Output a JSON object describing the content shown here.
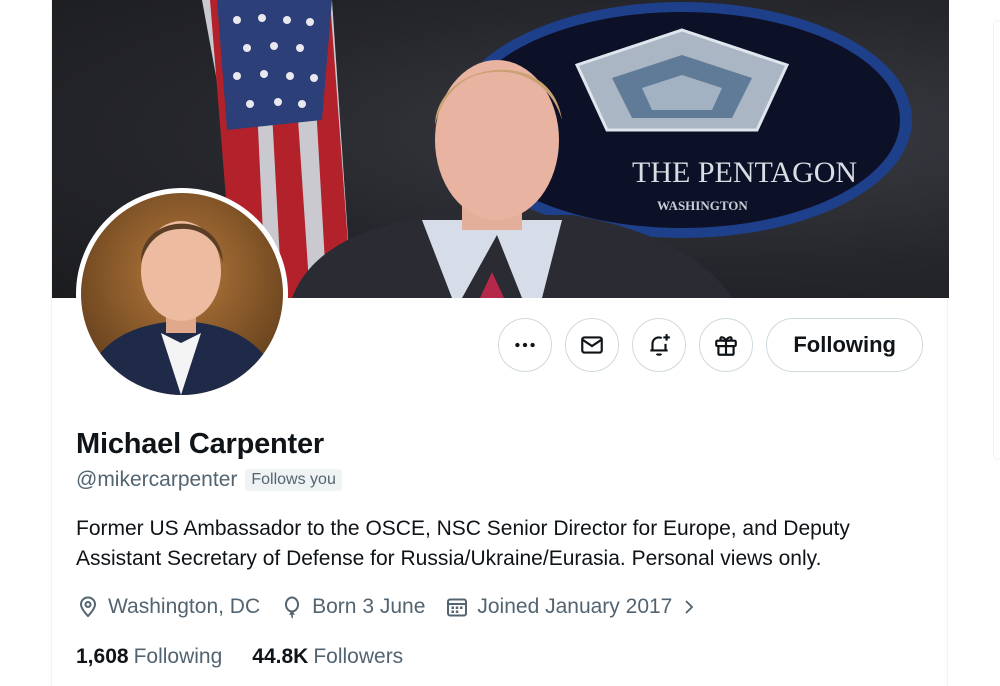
{
  "banner": {
    "sign_title": "THE PENTAGON",
    "sign_subtitle": "WASHINGTON"
  },
  "actions": {
    "more_icon": "more-icon",
    "message_icon": "envelope-icon",
    "notify_icon": "bell-plus-icon",
    "subscribe_icon": "gift-icon",
    "follow_label": "Following"
  },
  "profile": {
    "name": "Michael Carpenter",
    "handle": "@mikercarpenter",
    "follows_you": "Follows you",
    "bio": "Former US Ambassador to the OSCE, NSC Senior Director for Europe, and Deputy Assistant Secretary of Defense for Russia/Ukraine/Eurasia. Personal views only.",
    "location": "Washington, DC",
    "birthday": "Born 3 June",
    "joined": "Joined January 2017"
  },
  "stats": {
    "following_count": "1,608",
    "following_label": "Following",
    "followers_count": "44.8K",
    "followers_label": "Followers"
  },
  "colors": {
    "text": "#0f1419",
    "secondary": "#536471",
    "border": "#cfd9de"
  }
}
